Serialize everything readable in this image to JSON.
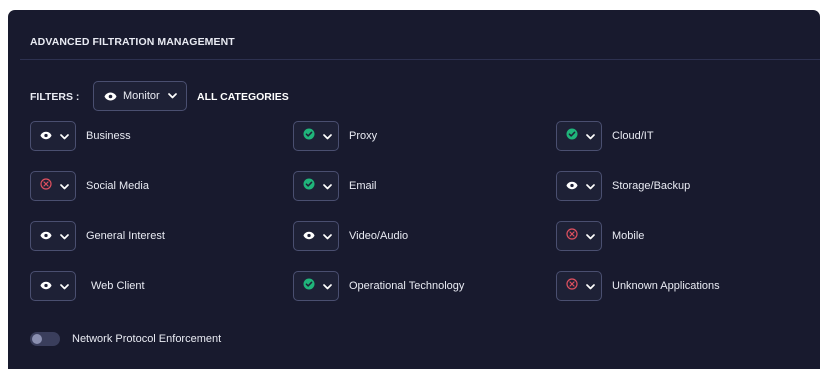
{
  "panel": {
    "title": "ADVANCED FILTRATION MANAGEMENT"
  },
  "filters": {
    "label": "FILTERS :",
    "mode": "Monitor",
    "mode_icon": "eye-icon",
    "scope": "ALL CATEGORIES"
  },
  "colors": {
    "panel_bg": "#181a2e",
    "allow_green": "#1fb57a",
    "block_red": "#e0505f",
    "border": "#4a4f70"
  },
  "categories": [
    {
      "label": "Business",
      "state": "monitor"
    },
    {
      "label": "Proxy",
      "state": "allow"
    },
    {
      "label": "Cloud/IT",
      "state": "allow"
    },
    {
      "label": "Social Media",
      "state": "block"
    },
    {
      "label": "Email",
      "state": "allow"
    },
    {
      "label": "Storage/Backup",
      "state": "monitor"
    },
    {
      "label": "General Interest",
      "state": "monitor"
    },
    {
      "label": "Video/Audio",
      "state": "monitor"
    },
    {
      "label": "Mobile",
      "state": "block"
    },
    {
      "label": "Web Client",
      "state": "monitor"
    },
    {
      "label": "Operational Technology",
      "state": "allow"
    },
    {
      "label": "Unknown Applications",
      "state": "block"
    }
  ],
  "toggle": {
    "label": "Network Protocol Enforcement",
    "enabled": false
  }
}
